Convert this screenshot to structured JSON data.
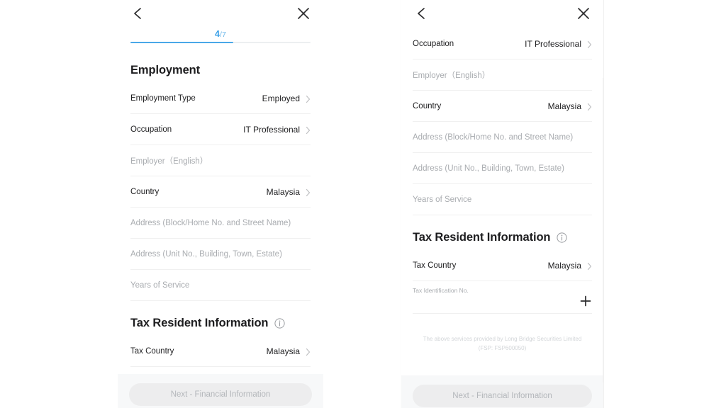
{
  "app": {
    "background_color": "#ffffff",
    "accent_color": "#4aa8e8",
    "panel_color": "#ffffff"
  },
  "left_panel": {
    "nav": {
      "back_icon": "chevron-left-icon",
      "close_icon": "close-icon"
    },
    "progress": {
      "current": "4",
      "separator": "/7",
      "percent": 57
    },
    "section_employment": {
      "title": "Employment",
      "rows": [
        {
          "label": "Employment Type",
          "value": "Employed",
          "type": "select",
          "chevron": true
        },
        {
          "label": "Occupation",
          "value": "IT Professional",
          "type": "select",
          "chevron": true
        },
        {
          "placeholder": "Employer（English）",
          "type": "input",
          "chevron": false
        },
        {
          "label": "Country",
          "value": "Malaysia",
          "type": "select",
          "chevron": true
        },
        {
          "placeholder": "Address (Block/Home No. and Street Name)",
          "type": "input",
          "chevron": false
        },
        {
          "placeholder": "Address (Unit No., Building, Town, Estate)",
          "type": "input",
          "chevron": false
        },
        {
          "placeholder": "Years of Service",
          "type": "input",
          "chevron": false
        }
      ]
    },
    "section_tax": {
      "title": "Tax Resident Information",
      "info_icon": "info-circle-icon",
      "rows": [
        {
          "label": "Tax Country",
          "value": "Malaysia",
          "type": "select",
          "chevron": true
        }
      ]
    },
    "bottom": {
      "next_label": "Next - Financial Information"
    }
  },
  "right_panel": {
    "nav": {
      "back_icon": "chevron-left-icon",
      "close_icon": "close-icon"
    },
    "rows": [
      {
        "label": "Occupation",
        "value": "IT Professional",
        "type": "select",
        "chevron": true
      },
      {
        "placeholder": "Employer（English）",
        "type": "input",
        "chevron": false
      },
      {
        "label": "Country",
        "value": "Malaysia",
        "type": "select",
        "chevron": true
      },
      {
        "placeholder": "Address (Block/Home No. and Street Name)",
        "type": "input",
        "chevron": false
      },
      {
        "placeholder": "Address (Unit No., Building, Town, Estate)",
        "type": "input",
        "chevron": false
      },
      {
        "placeholder": "Years of Service",
        "type": "input",
        "chevron": false
      }
    ],
    "section_tax": {
      "title": "Tax Resident Information",
      "info_icon": "info-circle-icon",
      "tax_country": {
        "label": "Tax Country",
        "value": "Malaysia"
      },
      "tax_id": {
        "label": "Tax Identification No.",
        "add_icon": "plus-icon"
      }
    },
    "disclaimer": {
      "line1": "The above services provided by Long Bridge Securities Limited",
      "line2": "(FSP: FSP600050)"
    },
    "bottom": {
      "next_label": "Next - Financial Information"
    }
  }
}
